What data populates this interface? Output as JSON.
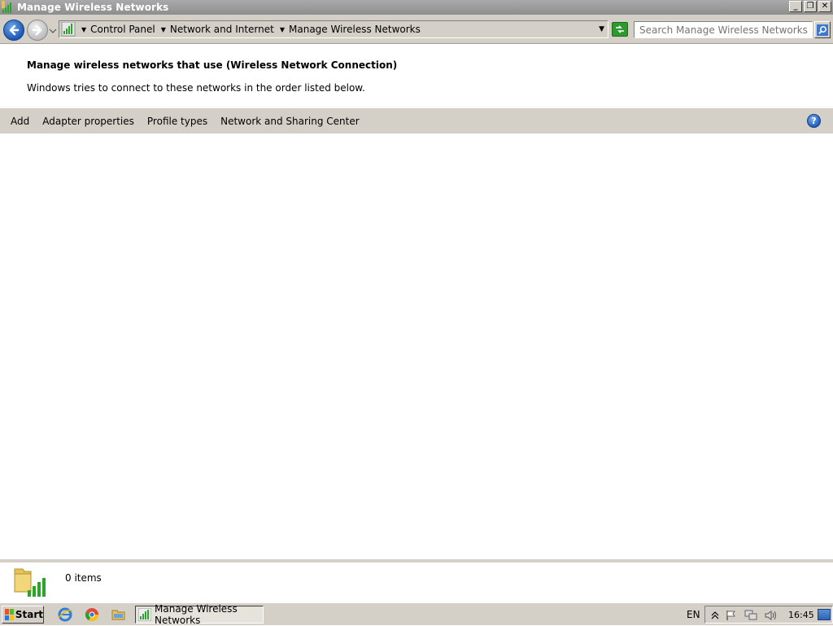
{
  "window": {
    "title": "Manage Wireless Networks",
    "controls": {
      "minimize": "_",
      "maximize": "❐",
      "close": "✕"
    }
  },
  "addressbar": {
    "breadcrumbs": [
      "Control Panel",
      "Network and Internet",
      "Manage Wireless Networks"
    ],
    "search_placeholder": "Search Manage Wireless Networks",
    "search_value": ""
  },
  "header": {
    "title": "Manage wireless networks that use (Wireless Network Connection)",
    "description": "Windows tries to connect to these networks in the order listed below."
  },
  "commandbar": {
    "items": [
      "Add",
      "Adapter properties",
      "Profile types",
      "Network and Sharing Center"
    ],
    "help_label": "?"
  },
  "details": {
    "item_count": "0 items"
  },
  "taskbar": {
    "start_label": "Start",
    "quick_launch": [
      "internet-explorer-icon",
      "chrome-icon",
      "explorer-icon"
    ],
    "active_window": "Manage Wireless Networks",
    "language": "EN",
    "clock": "16:45"
  },
  "colors": {
    "chrome": "#d4d0c8",
    "titlebar": "#8e8e8e",
    "accent_blue": "#1b58b8",
    "signal_green": "#2aa52a"
  }
}
